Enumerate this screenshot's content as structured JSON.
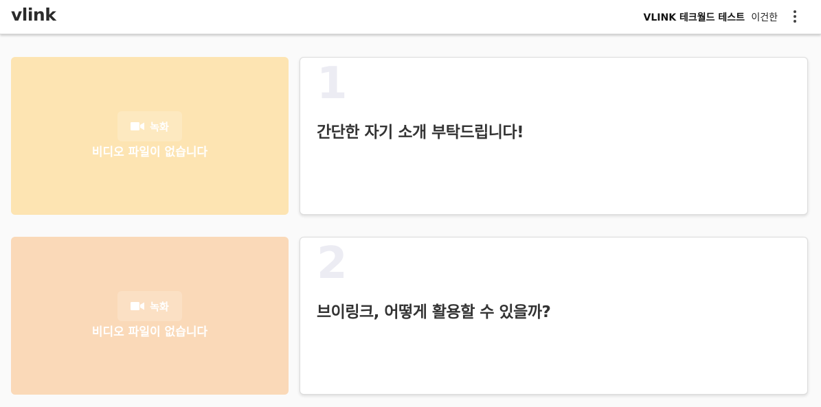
{
  "header": {
    "logo": "vlink",
    "org_name": "VLINK 테크월드 테스트",
    "user_name": "이건한",
    "menu_icon": "more-vertical-icon"
  },
  "questions": [
    {
      "number": "1",
      "text": "간단한 자기 소개 부탁드립니다!",
      "video": {
        "record_label": "녹화",
        "record_icon": "video-camera-icon",
        "empty_message": "비디오 파일이 없습니다",
        "bg_color": "#fde4b2"
      }
    },
    {
      "number": "2",
      "text": "브이링크, 어떻게 활용할 수 있을까?",
      "video": {
        "record_label": "녹화",
        "record_icon": "video-camera-icon",
        "empty_message": "비디오 파일이 없습니다",
        "bg_color": "#fad9b8"
      }
    }
  ]
}
